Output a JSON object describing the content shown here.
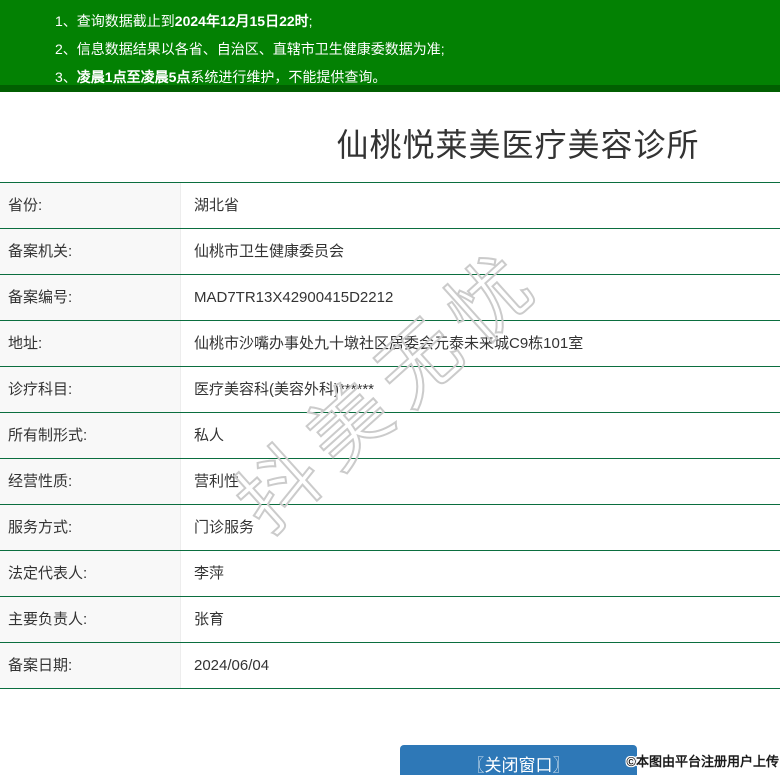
{
  "notice": {
    "lines": [
      {
        "pre": "1、查询数据截止到",
        "bold": "2024年12月15日22时",
        "post": ";"
      },
      {
        "pre": "2、信息数据结果以各省、自治区、直辖市卫生健康委数据为准;",
        "bold": "",
        "post": ""
      },
      {
        "pre": "3、",
        "bold": "凌晨1点至凌晨5点",
        "post": "系统进行维护，不能提供查询。"
      }
    ]
  },
  "header": {
    "title": "仙桃悦莱美医疗美容诊所"
  },
  "table": {
    "rows": [
      {
        "label": "省份:",
        "value": "湖北省"
      },
      {
        "label": "备案机关:",
        "value": "仙桃市卫生健康委员会"
      },
      {
        "label": "备案编号:",
        "value": "MAD7TR13X42900415D2212"
      },
      {
        "label": "地址:",
        "value": "仙桃市沙嘴办事处九十墩社区居委会元泰未来城C9栋101室"
      },
      {
        "label": "诊疗科目:",
        "value": "医疗美容科(美容外科)******"
      },
      {
        "label": "所有制形式:",
        "value": "私人"
      },
      {
        "label": "经营性质:",
        "value": "营利性"
      },
      {
        "label": "服务方式:",
        "value": "门诊服务"
      },
      {
        "label": "法定代表人:",
        "value": "李萍"
      },
      {
        "label": "主要负责人:",
        "value": "张育"
      },
      {
        "label": "备案日期:",
        "value": "2024/06/04"
      }
    ]
  },
  "watermark": {
    "text": "抖美无忧"
  },
  "footer": {
    "close_button_label": "〖关闭窗口〗",
    "copyright": "©本图由平台注册用户上传"
  },
  "colors": {
    "banner_green": "#038103",
    "banner_strip_green": "#015f01",
    "divider_green": "#0b6e3f",
    "label_bg": "#f8f8f8",
    "button_blue": "#2e78b7",
    "watermark_gray": "#cbcbcb"
  }
}
